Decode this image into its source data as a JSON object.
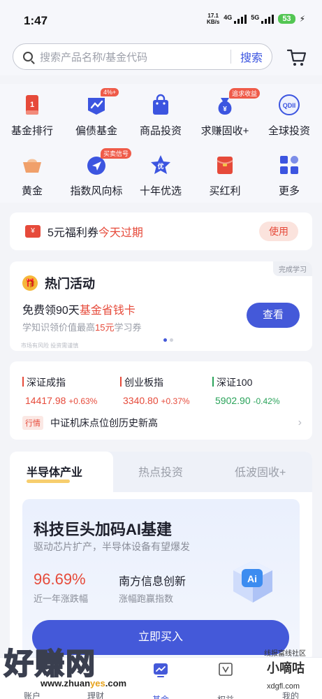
{
  "status_bar": {
    "time": "1:47",
    "net_speed_value": "17.1",
    "net_speed_unit": "KB/s",
    "signal1_label": "4G",
    "signal2_label": "5G",
    "battery": "53"
  },
  "search": {
    "placeholder": "搜索产品名称/基金代码",
    "button": "搜索"
  },
  "grid": [
    {
      "label": "基金排行",
      "icon": "ranking-icon"
    },
    {
      "label": "偏债基金",
      "icon": "bond-fund-icon",
      "tag": "4%+"
    },
    {
      "label": "商品投资",
      "icon": "shopping-bag-icon"
    },
    {
      "label": "求赚固收+",
      "icon": "money-bag-icon",
      "tag": "追求收益"
    },
    {
      "label": "全球投资",
      "icon": "qdii-icon",
      "icon_text": "QDII"
    },
    {
      "label": "黄金",
      "icon": "gold-ingot-icon"
    },
    {
      "label": "指数风向标",
      "icon": "compass-icon",
      "tag": "买卖信号"
    },
    {
      "label": "十年优选",
      "icon": "star-badge-icon",
      "icon_text": "优"
    },
    {
      "label": "买红利",
      "icon": "red-envelope-icon"
    },
    {
      "label": "更多",
      "icon": "more-grid-icon"
    }
  ],
  "coupon": {
    "text": "5元福利券",
    "highlight": "今天过期",
    "button": "使用",
    "icon_text": "¥"
  },
  "activity": {
    "corner": "完成学习",
    "title": "热门活动",
    "line1_a": "免费领90天",
    "line1_b": "基金省钱卡",
    "line2_a": "学知识领价值最高",
    "line2_b": "15元",
    "line2_c": "学习券",
    "button": "查看",
    "disclaimer": "市场有风险 投资需谨慎"
  },
  "market": {
    "indices": [
      {
        "name": "深证成指",
        "value": "14417.98",
        "change": "+0.63%",
        "color": "#e64a3a"
      },
      {
        "name": "创业板指",
        "value": "3340.80",
        "change": "+0.37%",
        "color": "#e64a3a"
      },
      {
        "name": "深证100",
        "value": "5902.90",
        "change": "-0.42%",
        "color": "#2aa35a"
      }
    ],
    "news_tag": "行情",
    "news_text": "中证机床点位创历史新高"
  },
  "fund_tabs": [
    "半导体产业",
    "热点投资",
    "低波固收+"
  ],
  "promo": {
    "title": "科技巨头加码AI基建",
    "subtitle": "驱动芯片扩产，半导体设备有望爆发",
    "rate": "96.69%",
    "rate_label": "近一年涨跌幅",
    "index_name": "南方信息创新",
    "index_label": "涨幅跑赢指数",
    "cube_text": "Ai",
    "buy_button": "立即买入"
  },
  "tabbar": [
    {
      "label": "账户",
      "icon": "account-icon"
    },
    {
      "label": "理财",
      "icon": "wealth-icon"
    },
    {
      "label": "基金",
      "icon": "fund-chart-icon",
      "active": true
    },
    {
      "label": "权益",
      "icon": "benefits-icon"
    },
    {
      "label": "我的",
      "icon": "profile-icon"
    }
  ],
  "watermark": {
    "big": "好赚网",
    "url_a": "www.zhuan",
    "url_b": "yes",
    "url_c": ".com",
    "right_top": "线报富线社区",
    "right_mid": "小嘀咕",
    "right_bot": "xdgfl.com"
  },
  "colors": {
    "accent": "#4459d9",
    "red": "#e64a3a",
    "green": "#2aa35a"
  }
}
